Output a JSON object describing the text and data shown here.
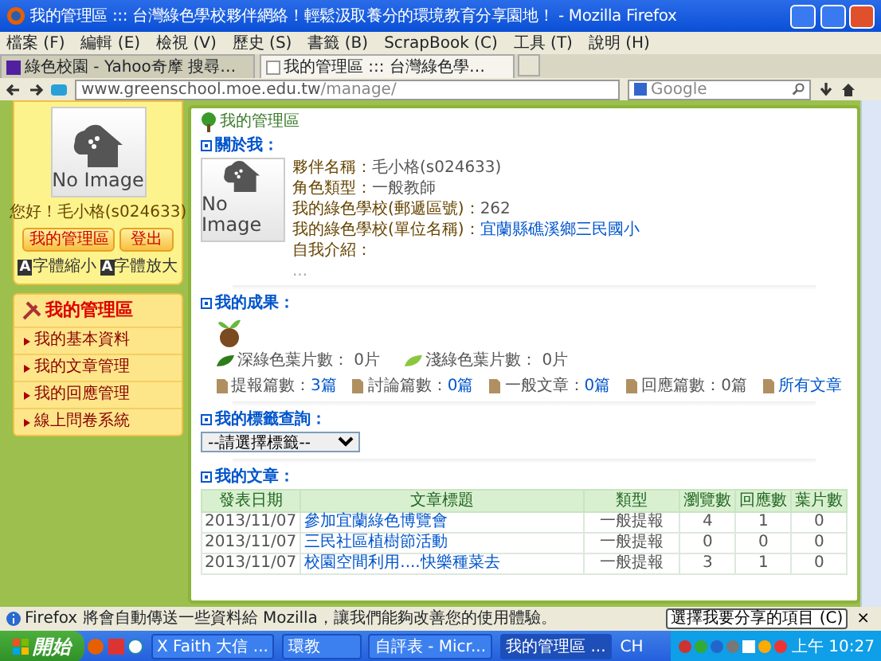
{
  "window": {
    "title": "我的管理區 ::: 台灣綠色學校夥伴網絡！輕鬆汲取養分的環境教育分享園地！ - Mozilla Firefox"
  },
  "menu": [
    "檔案 (F)",
    "編輯 (E)",
    "檢視 (V)",
    "歷史 (S)",
    "書籤 (B)",
    "ScrapBook (C)",
    "工具 (T)",
    "說明 (H)"
  ],
  "tabs": [
    {
      "label": "綠色校園 - Yahoo奇摩 搜尋…",
      "selected": false
    },
    {
      "label": "我的管理區 ::: 台灣綠色學…",
      "selected": true
    }
  ],
  "address": {
    "host": "www.greenschool.moe.edu.tw",
    "path": "/manage/"
  },
  "search": {
    "placeholder": "Google"
  },
  "sidebar": {
    "photo_text": "No Image",
    "greeting": "您好！毛小格(s024633)",
    "buttons": [
      "我的管理區",
      "登出"
    ],
    "font_buttons": [
      {
        "icon": "A",
        "label": "字體縮小"
      },
      {
        "icon": "A",
        "label": "字體放大"
      }
    ],
    "menu_title": "我的管理區",
    "menu_items": [
      "我的基本資料",
      "我的文章管理",
      "我的回應管理",
      "線上問卷系統"
    ]
  },
  "main": {
    "title": "我的管理區",
    "about": {
      "title": "關於我：",
      "photo_text": "No Image",
      "fields": [
        {
          "label": "夥伴名稱：",
          "value": "毛小格(s024633)",
          "kind": "text"
        },
        {
          "label": "角色類型：",
          "value": "一般教師",
          "kind": "text"
        },
        {
          "label": "我的綠色學校(郵遞區號)：",
          "value": "262",
          "kind": "text"
        },
        {
          "label": "我的綠色學校(單位名稱)：",
          "value": "宜蘭縣礁溪鄉三民國小",
          "kind": "link"
        },
        {
          "label": "自我介紹："
        }
      ],
      "more": "..."
    },
    "achievements": {
      "title": "我的成果：",
      "leaves": [
        {
          "label": "深綠色葉片數：",
          "value": "0片",
          "color": "#2e7d1a"
        },
        {
          "label": "淺綠色葉片數：",
          "value": "0片",
          "color": "#8cc63f"
        }
      ],
      "stats": [
        {
          "label": "提報篇數：",
          "value": "3篇"
        },
        {
          "label": "討論篇數：",
          "value": "0篇"
        },
        {
          "label": "一般文章：",
          "value": "0篇"
        },
        {
          "label": "回應篇數：",
          "value": "0篇",
          "kind": "plain"
        },
        {
          "label": "所有文章",
          "kind": "link"
        }
      ]
    },
    "tags": {
      "title": "我的標籤查詢：",
      "select": "--請選擇標籤--"
    },
    "articles": {
      "title": "我的文章：",
      "columns": [
        "發表日期",
        "文章標題",
        "類型",
        "瀏覽數",
        "回應數",
        "葉片數"
      ],
      "rows": [
        [
          "2013/11/07",
          "參加宜蘭綠色博覽會",
          "一般提報",
          "4",
          "1",
          "0"
        ],
        [
          "2013/11/07",
          "三民社區植樹節活動",
          "一般提報",
          "0",
          "0",
          "0"
        ],
        [
          "2013/11/07",
          "校園空間利用....快樂種菜去",
          "一般提報",
          "3",
          "1",
          "0"
        ]
      ]
    }
  },
  "notification": {
    "text": "Firefox 將會自動傳送一些資料給 Mozilla，讓我們能夠改善您的使用體驗。",
    "button": "選擇我要分享的項目 (C)",
    "close": "×"
  },
  "taskbar": {
    "start": "開始",
    "tasks": [
      {
        "label": "X Faith 大信 ...",
        "selected": false
      },
      {
        "label": "環教",
        "selected": false
      },
      {
        "label": "自評表 - Micr...",
        "selected": false
      },
      {
        "label": "我的管理區 ...",
        "selected": true
      }
    ],
    "lang": "CH",
    "clock": "上午 10:27"
  }
}
